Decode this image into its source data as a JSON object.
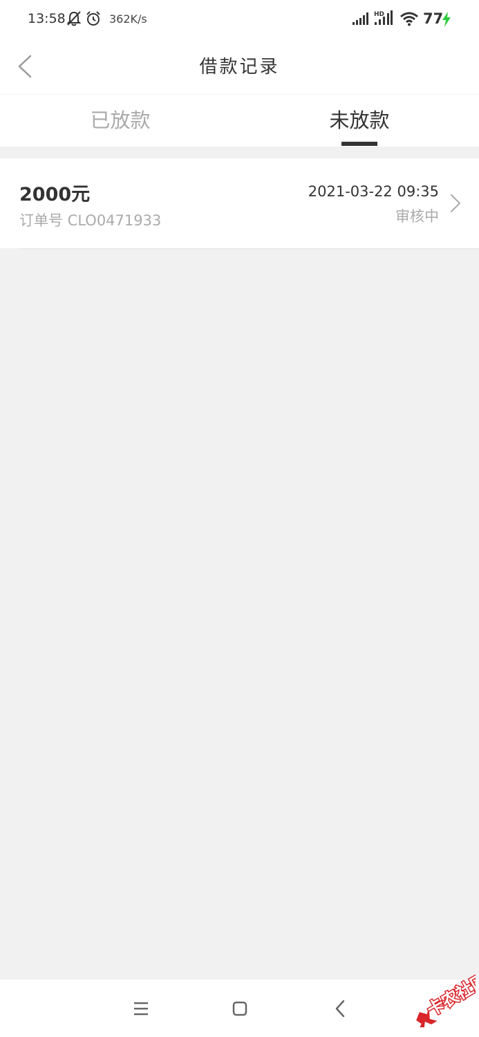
{
  "status_bar": {
    "time": "13:58",
    "speed": "362K/s",
    "battery": "77",
    "icons": [
      "bell-off-icon",
      "alarm-icon",
      "signal-icon",
      "hd-signal-icon",
      "wifi-icon",
      "charging-icon"
    ]
  },
  "header": {
    "title": "借款记录",
    "back_icon": "chevron-left-icon"
  },
  "tabs": [
    {
      "label": "已放款",
      "active": false
    },
    {
      "label": "未放款",
      "active": true
    }
  ],
  "records": [
    {
      "amount": "2000元",
      "order_no": "订单号 CLO0471933",
      "datetime": "2021-03-22 09:35",
      "status": "审核中"
    }
  ],
  "nav": {
    "icons": [
      "menu-icon",
      "home-square-icon",
      "back-triangle-icon"
    ]
  },
  "watermark": {
    "text": "卡农社区"
  },
  "colors": {
    "background": "#f1f1f1",
    "card": "#ffffff",
    "text_primary": "#333333",
    "text_secondary": "#aaaaaa",
    "charging": "#2ecc40",
    "watermark_red": "#d9262b"
  }
}
